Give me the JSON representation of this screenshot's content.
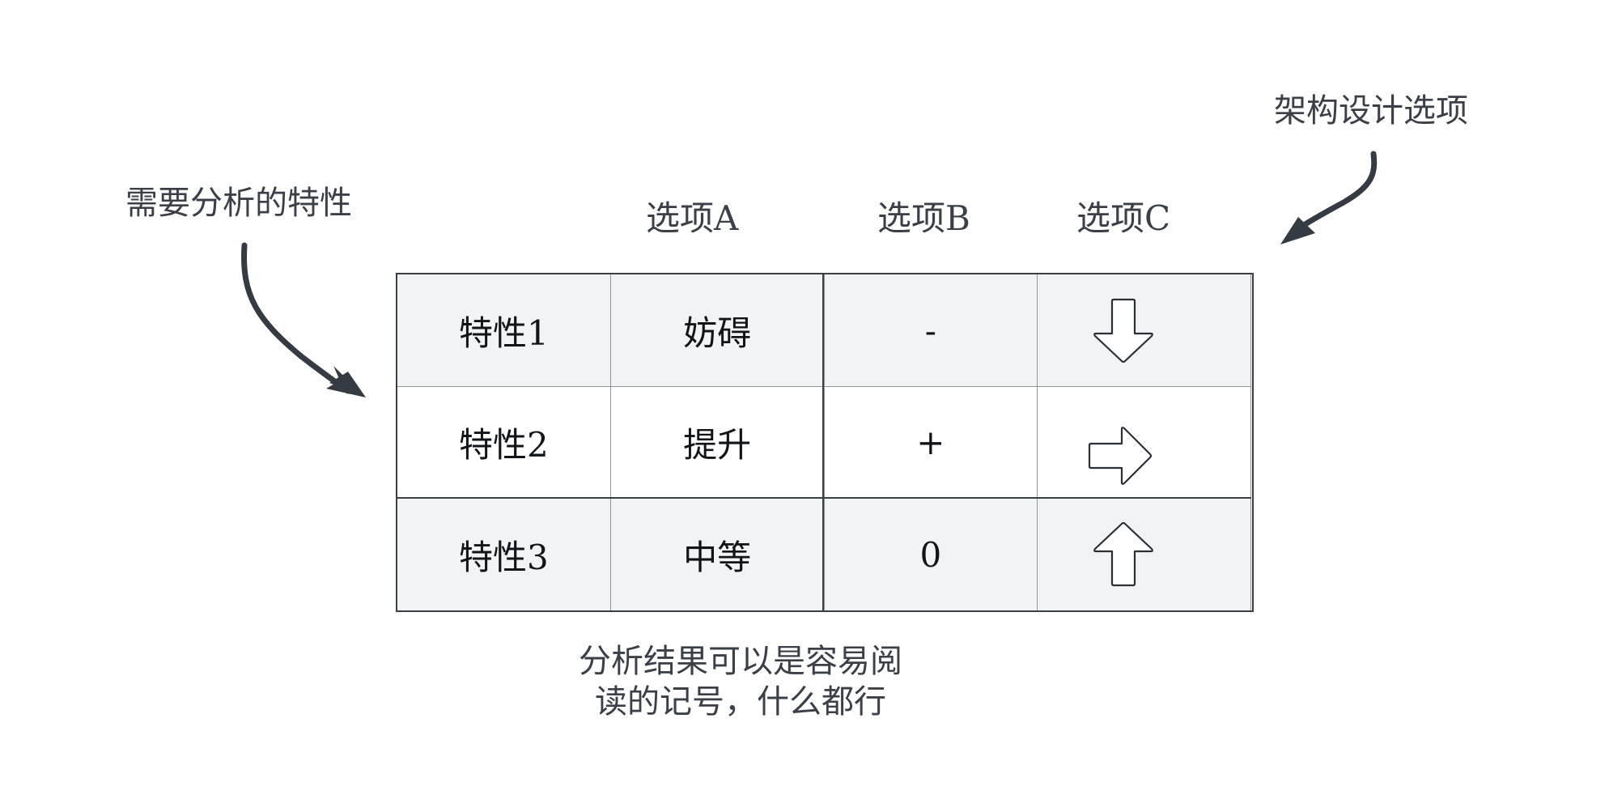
{
  "labels": {
    "left": "需要分析的特性",
    "right": "架构设计选项"
  },
  "columns": [
    "选项A",
    "选项B",
    "选项C"
  ],
  "rows": [
    {
      "feature": "特性1",
      "option_a": "妨碍",
      "option_b": "-",
      "option_c_icon": "arrow-down-icon"
    },
    {
      "feature": "特性2",
      "option_a": "提升",
      "option_b": "+",
      "option_c_icon": "arrow-right-icon"
    },
    {
      "feature": "特性3",
      "option_a": "中等",
      "option_b": "0",
      "option_c_icon": "arrow-up-icon"
    }
  ],
  "note": {
    "line1": "分析结果可以是容易阅",
    "line2": "读的记号，什么都行"
  },
  "colors": {
    "arrow": "#353b43",
    "shaded_row": "#f2f3f5",
    "border": "#3a3f45"
  }
}
